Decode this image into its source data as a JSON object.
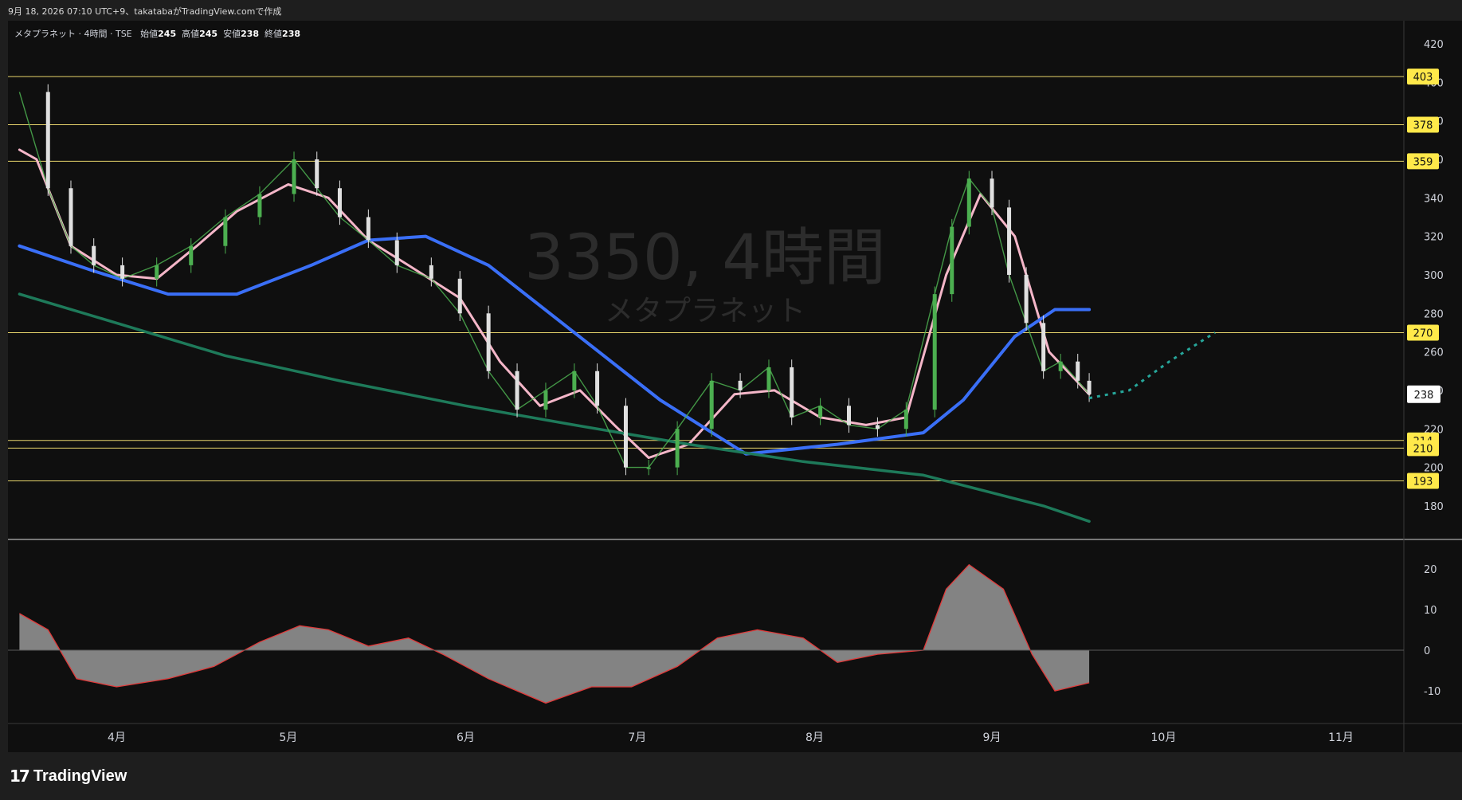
{
  "header": {
    "caption": "9月 18, 2026 07:10 UTC+9、takatabaがTradingView.comで作成"
  },
  "legend": {
    "symbol": "メタプラネット · 4時間 · TSE",
    "open_label": "始値",
    "open": "245",
    "high_label": "高値",
    "high": "245",
    "low_label": "安値",
    "low": "238",
    "close_label": "終値",
    "close": "238"
  },
  "watermark": {
    "line1": "3350, 4時間",
    "line2": "メタプラネット"
  },
  "footer": {
    "logo_text": "TradingView"
  },
  "colors": {
    "background": "#0f0f0f",
    "up": "#4caf50",
    "down": "#e0e0e0",
    "hline": "#e6d36b",
    "ma_pink": "#f4b6c8",
    "ma_blue_thick": "#3a6ff7",
    "ma_green_thick": "#1e7a5a",
    "bb_blue": "#3d7cc9",
    "channel_white": "#e8e8e8",
    "oscillator_fill": "#8a8a8a",
    "signal_red": "#e03a3a"
  },
  "chart_data": [
    {
      "type": "candlestick",
      "title": "",
      "x_ticks": [
        "4月",
        "5月",
        "6月",
        "7月",
        "8月",
        "9月",
        "10月",
        "11月"
      ],
      "y_ticks": [
        180,
        200,
        220,
        240,
        260,
        280,
        300,
        320,
        340,
        360,
        380,
        400,
        420
      ],
      "ylim": [
        163,
        432
      ],
      "horizontal_levels": [
        403,
        378,
        359,
        270,
        214,
        210,
        193
      ],
      "last_price": 238,
      "close_path": [
        {
          "x": "2026-03-15",
          "y": 395
        },
        {
          "x": "2026-03-20",
          "y": 345
        },
        {
          "x": "2026-03-24",
          "y": 315
        },
        {
          "x": "2026-03-28",
          "y": 305
        },
        {
          "x": "2026-04-02",
          "y": 298
        },
        {
          "x": "2026-04-08",
          "y": 305
        },
        {
          "x": "2026-04-14",
          "y": 315
        },
        {
          "x": "2026-04-20",
          "y": 330
        },
        {
          "x": "2026-04-26",
          "y": 342
        },
        {
          "x": "2026-05-02",
          "y": 360
        },
        {
          "x": "2026-05-06",
          "y": 345
        },
        {
          "x": "2026-05-10",
          "y": 330
        },
        {
          "x": "2026-05-15",
          "y": 318
        },
        {
          "x": "2026-05-20",
          "y": 305
        },
        {
          "x": "2026-05-26",
          "y": 298
        },
        {
          "x": "2026-05-31",
          "y": 280
        },
        {
          "x": "2026-06-05",
          "y": 250
        },
        {
          "x": "2026-06-10",
          "y": 230
        },
        {
          "x": "2026-06-15",
          "y": 240
        },
        {
          "x": "2026-06-20",
          "y": 250
        },
        {
          "x": "2026-06-24",
          "y": 232
        },
        {
          "x": "2026-06-29",
          "y": 200
        },
        {
          "x": "2026-07-03",
          "y": 200
        },
        {
          "x": "2026-07-08",
          "y": 220
        },
        {
          "x": "2026-07-14",
          "y": 245
        },
        {
          "x": "2026-07-19",
          "y": 240
        },
        {
          "x": "2026-07-24",
          "y": 252
        },
        {
          "x": "2026-07-28",
          "y": 226
        },
        {
          "x": "2026-08-02",
          "y": 232
        },
        {
          "x": "2026-08-07",
          "y": 222
        },
        {
          "x": "2026-08-12",
          "y": 220
        },
        {
          "x": "2026-08-17",
          "y": 230
        },
        {
          "x": "2026-08-22",
          "y": 290
        },
        {
          "x": "2026-08-25",
          "y": 325
        },
        {
          "x": "2026-08-28",
          "y": 350
        },
        {
          "x": "2026-09-01",
          "y": 335
        },
        {
          "x": "2026-09-04",
          "y": 300
        },
        {
          "x": "2026-09-07",
          "y": 275
        },
        {
          "x": "2026-09-10",
          "y": 250
        },
        {
          "x": "2026-09-13",
          "y": 255
        },
        {
          "x": "2026-09-16",
          "y": 245
        },
        {
          "x": "2026-09-18",
          "y": 238
        }
      ],
      "series": [
        {
          "values": [
            {
              "x": "2026-03-15",
              "y": 365
            },
            {
              "x": "2026-03-18",
              "y": 360
            },
            {
              "x": "2026-03-24",
              "y": 315
            },
            {
              "x": "2026-04-01",
              "y": 300
            },
            {
              "x": "2026-04-08",
              "y": 298
            },
            {
              "x": "2026-04-15",
              "y": 315
            },
            {
              "x": "2026-04-22",
              "y": 333
            },
            {
              "x": "2026-05-01",
              "y": 347
            },
            {
              "x": "2026-05-08",
              "y": 340
            },
            {
              "x": "2026-05-15",
              "y": 318
            },
            {
              "x": "2026-05-22",
              "y": 305
            },
            {
              "x": "2026-05-31",
              "y": 288
            },
            {
              "x": "2026-06-07",
              "y": 255
            },
            {
              "x": "2026-06-14",
              "y": 232
            },
            {
              "x": "2026-06-21",
              "y": 240
            },
            {
              "x": "2026-06-27",
              "y": 222
            },
            {
              "x": "2026-07-03",
              "y": 205
            },
            {
              "x": "2026-07-10",
              "y": 212
            },
            {
              "x": "2026-07-18",
              "y": 238
            },
            {
              "x": "2026-07-25",
              "y": 240
            },
            {
              "x": "2026-08-02",
              "y": 226
            },
            {
              "x": "2026-08-10",
              "y": 222
            },
            {
              "x": "2026-08-17",
              "y": 226
            },
            {
              "x": "2026-08-24",
              "y": 300
            },
            {
              "x": "2026-08-30",
              "y": 342
            },
            {
              "x": "2026-09-05",
              "y": 320
            },
            {
              "x": "2026-09-11",
              "y": 260
            },
            {
              "x": "2026-09-18",
              "y": 238
            }
          ]
        },
        {
          "values": [
            {
              "x": "2026-03-15",
              "y": 315
            },
            {
              "x": "2026-03-28",
              "y": 302
            },
            {
              "x": "2026-04-10",
              "y": 290
            },
            {
              "x": "2026-04-22",
              "y": 290
            },
            {
              "x": "2026-05-05",
              "y": 305
            },
            {
              "x": "2026-05-15",
              "y": 318
            },
            {
              "x": "2026-05-25",
              "y": 320
            },
            {
              "x": "2026-06-05",
              "y": 305
            },
            {
              "x": "2026-06-20",
              "y": 270
            },
            {
              "x": "2026-07-05",
              "y": 235
            },
            {
              "x": "2026-07-20",
              "y": 207
            },
            {
              "x": "2026-08-05",
              "y": 212
            },
            {
              "x": "2026-08-20",
              "y": 218
            },
            {
              "x": "2026-08-27",
              "y": 235
            },
            {
              "x": "2026-09-05",
              "y": 268
            },
            {
              "x": "2026-09-12",
              "y": 282
            },
            {
              "x": "2026-09-18",
              "y": 282
            }
          ]
        },
        {
          "values": [
            {
              "x": "2026-03-15",
              "y": 290
            },
            {
              "x": "2026-04-01",
              "y": 275
            },
            {
              "x": "2026-04-20",
              "y": 258
            },
            {
              "x": "2026-05-10",
              "y": 245
            },
            {
              "x": "2026-06-01",
              "y": 232
            },
            {
              "x": "2026-06-20",
              "y": 222
            },
            {
              "x": "2026-07-10",
              "y": 212
            },
            {
              "x": "2026-07-30",
              "y": 203
            },
            {
              "x": "2026-08-20",
              "y": 196
            },
            {
              "x": "2026-09-10",
              "y": 180
            },
            {
              "x": "2026-09-18",
              "y": 172
            }
          ]
        }
      ],
      "projection_points": [
        {
          "x": "2026-09-18",
          "y": 236
        },
        {
          "x": "2026-09-25",
          "y": 240
        },
        {
          "x": "2026-10-02",
          "y": 255
        },
        {
          "x": "2026-10-10",
          "y": 270
        }
      ],
      "oscillator": {
        "y_ticks": [
          20,
          10,
          0,
          -10
        ],
        "ylim": [
          -18,
          27
        ],
        "values": [
          {
            "x": "2026-03-15",
            "y": 9
          },
          {
            "x": "2026-03-20",
            "y": 5
          },
          {
            "x": "2026-03-25",
            "y": -7
          },
          {
            "x": "2026-04-01",
            "y": -9
          },
          {
            "x": "2026-04-10",
            "y": -7
          },
          {
            "x": "2026-04-18",
            "y": -4
          },
          {
            "x": "2026-04-26",
            "y": 2
          },
          {
            "x": "2026-05-03",
            "y": 6
          },
          {
            "x": "2026-05-08",
            "y": 5
          },
          {
            "x": "2026-05-15",
            "y": 1
          },
          {
            "x": "2026-05-22",
            "y": 3
          },
          {
            "x": "2026-05-28",
            "y": -1
          },
          {
            "x": "2026-06-05",
            "y": -7
          },
          {
            "x": "2026-06-15",
            "y": -13
          },
          {
            "x": "2026-06-23",
            "y": -9
          },
          {
            "x": "2026-06-30",
            "y": -9
          },
          {
            "x": "2026-07-08",
            "y": -4
          },
          {
            "x": "2026-07-15",
            "y": 3
          },
          {
            "x": "2026-07-22",
            "y": 5
          },
          {
            "x": "2026-07-30",
            "y": 3
          },
          {
            "x": "2026-08-05",
            "y": -3
          },
          {
            "x": "2026-08-12",
            "y": -1
          },
          {
            "x": "2026-08-20",
            "y": 0
          },
          {
            "x": "2026-08-24",
            "y": 15
          },
          {
            "x": "2026-08-28",
            "y": 21
          },
          {
            "x": "2026-09-03",
            "y": 15
          },
          {
            "x": "2026-09-08",
            "y": -1
          },
          {
            "x": "2026-09-12",
            "y": -10
          },
          {
            "x": "2026-09-18",
            "y": -8
          }
        ]
      }
    }
  ]
}
